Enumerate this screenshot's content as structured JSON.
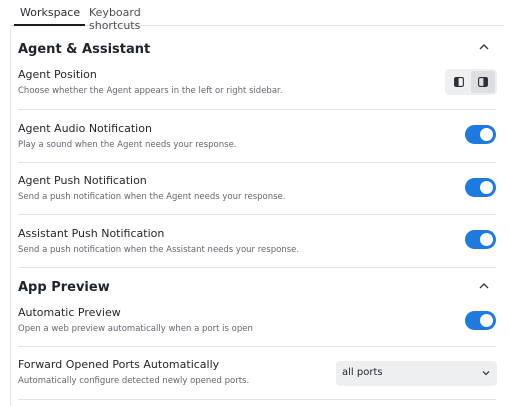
{
  "tabs": [
    {
      "label": "Workspace",
      "active": true
    },
    {
      "label": "Keyboard shortcuts",
      "active": false
    }
  ],
  "colors": {
    "accent": "#1f7ae0",
    "toggle_on": "#1f7ae0"
  },
  "agent_section": {
    "title": "Agent & Assistant",
    "collapse_icon": "chevron-up-icon",
    "position": {
      "label": "Agent Position",
      "description": "Choose whether the Agent appears in the left or right sidebar.",
      "options": [
        "left-sidebar-icon",
        "right-sidebar-icon"
      ],
      "selected": "right-sidebar-icon"
    },
    "audio_notification": {
      "label": "Agent Audio Notification",
      "description": "Play a sound when the Agent needs your response.",
      "enabled": true
    },
    "push_notification": {
      "label": "Agent Push Notification",
      "description": "Send a push notification when the Agent needs your response.",
      "enabled": true
    },
    "assistant_push_notification": {
      "label": "Assistant Push Notification",
      "description": "Send a push notification when the Assistant needs your response.",
      "enabled": true
    }
  },
  "preview_section": {
    "title": "App Preview",
    "collapse_icon": "chevron-up-icon",
    "automatic_preview": {
      "label": "Automatic Preview",
      "description": "Open a web preview automatically when a port is open",
      "enabled": true
    },
    "forward_ports": {
      "label": "Forward Opened Ports Automatically",
      "description": "Automatically configure detected newly opened ports.",
      "selected": "all ports"
    }
  }
}
